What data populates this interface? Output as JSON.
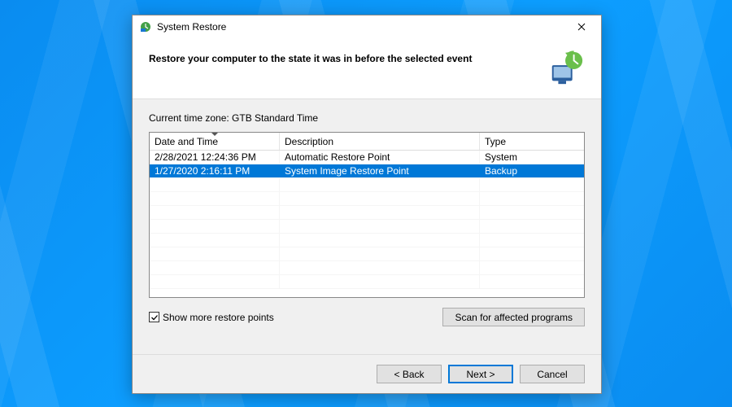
{
  "window": {
    "title": "System Restore"
  },
  "header": {
    "heading": "Restore your computer to the state it was in before the selected event"
  },
  "content": {
    "timezone_label": "Current time zone: GTB Standard Time",
    "columns": {
      "date": "Date and Time",
      "description": "Description",
      "type": "Type"
    },
    "rows": [
      {
        "date": "2/28/2021 12:24:36 PM",
        "description": "Automatic Restore Point",
        "type": "System",
        "selected": false
      },
      {
        "date": "1/27/2020 2:16:11 PM",
        "description": "System Image Restore Point",
        "type": "Backup",
        "selected": true
      }
    ],
    "show_more_label": "Show more restore points",
    "show_more_checked": true,
    "scan_button": "Scan for affected programs"
  },
  "footer": {
    "back": "< Back",
    "next": "Next >",
    "cancel": "Cancel"
  }
}
